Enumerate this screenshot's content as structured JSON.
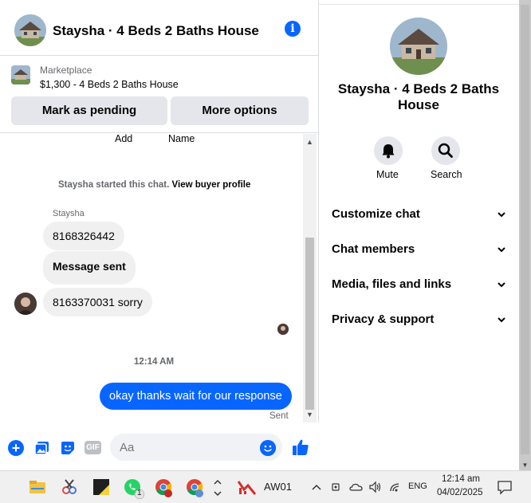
{
  "header": {
    "title": "Staysha · 4 Beds 2 Baths House"
  },
  "marketplace": {
    "label": "Marketplace",
    "listing": "$1,300 - 4 Beds 2 Baths House",
    "pending_button": "Mark as pending",
    "more_button": "More options"
  },
  "messages": {
    "col_add": "Add",
    "col_name": "Name",
    "started_prefix": "Staysha started this chat.",
    "view_profile": "View buyer profile",
    "sender": "Staysha",
    "incoming": [
      "8168326442",
      "Message sent",
      "8163370031 sorry"
    ],
    "timestamp": "12:14 AM",
    "outgoing": "okay thanks wait for our response",
    "sent_status": "Sent"
  },
  "composer": {
    "placeholder": "Aa",
    "gif": "GIF"
  },
  "info_panel": {
    "title": "Staysha · 4 Beds 2 Baths House",
    "mute_label": "Mute",
    "search_label": "Search",
    "sections": [
      "Customize chat",
      "Chat members",
      "Media, files and links",
      "Privacy & support"
    ]
  },
  "taskbar": {
    "app_label": "AW01",
    "whatsapp_badge": "1",
    "lang": "ENG",
    "time": "12:14 am",
    "date": "04/02/2025"
  },
  "colors": {
    "accent": "#0866ff",
    "bubble_in": "#f0f0f0",
    "button_bg": "#e4e6eb"
  }
}
